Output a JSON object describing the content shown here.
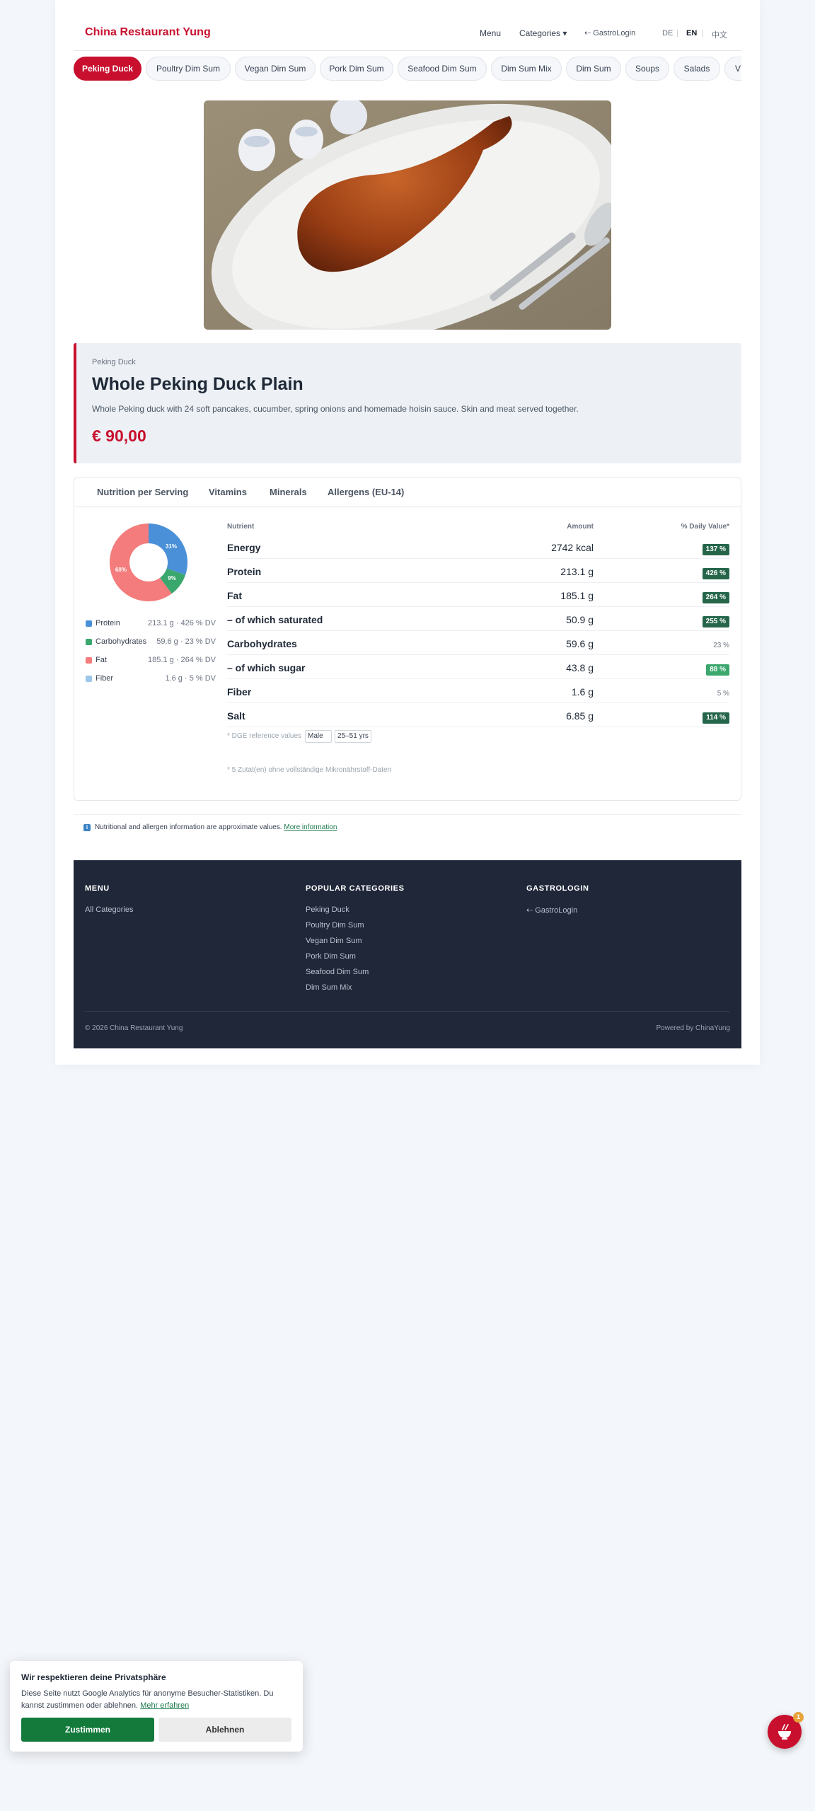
{
  "header": {
    "logo": "China Restaurant Yung",
    "nav_menu": "Menu",
    "nav_categories": "Categories ▾",
    "nav_login": "⇠ GastroLogin",
    "lang_de": "DE",
    "lang_sep": "|",
    "lang_en": "EN",
    "lang_zh": "中文"
  },
  "categories": [
    "Peking Duck",
    "Poultry Dim Sum",
    "Vegan Dim Sum",
    "Pork Dim Sum",
    "Seafood Dim Sum",
    "Dim Sum Mix",
    "Dim Sum",
    "Soups",
    "Salads",
    "V"
  ],
  "active_category": "Peking Duck",
  "dish": {
    "category": "Peking Duck",
    "title": "Whole Peking Duck Plain",
    "description": "Whole Peking duck with 24 soft pancakes, cucumber, spring onions and homemade hoisin sauce. Skin and meat served together.",
    "price": "€ 90,00"
  },
  "tabs": [
    "Nutrition per Serving",
    "Vitamins",
    "Minerals",
    "Allergens (EU-14)"
  ],
  "donut": {
    "labels": [
      "31%",
      "9%",
      "60%"
    ]
  },
  "legend": [
    {
      "name": "Protein",
      "value": "213.1 g · 426 % DV",
      "color": "#4a90d9"
    },
    {
      "name": "Carbohydrates",
      "value": "59.6 g · 23 % DV",
      "color": "#3aa76d"
    },
    {
      "name": "Fat",
      "value": "185.1 g · 264 % DV",
      "color": "#f47c7c"
    },
    {
      "name": "Fiber",
      "value": "1.6 g · 5 % DV",
      "color": "#9cc7ea"
    }
  ],
  "nutrition_table": {
    "col_nutrient": "Nutrient",
    "col_amount": "Amount",
    "col_dv": "% Daily Value*",
    "rows": [
      {
        "name": "Energy",
        "amount": "2742 kcal",
        "dv": "137 %",
        "style": "dark"
      },
      {
        "name": "Protein",
        "amount": "213.1 g",
        "dv": "426 %",
        "style": "dark"
      },
      {
        "name": "Fat",
        "amount": "185.1 g",
        "dv": "264 %",
        "style": "dark"
      },
      {
        "name": "– of which saturated",
        "amount": "50.9 g",
        "dv": "255 %",
        "style": "dark"
      },
      {
        "name": "Carbohydrates",
        "amount": "59.6 g",
        "dv": "23 %",
        "style": "plain"
      },
      {
        "name": "– of which sugar",
        "amount": "43.8 g",
        "dv": "88 %",
        "style": "light"
      },
      {
        "name": "Fiber",
        "amount": "1.6 g",
        "dv": "5 %",
        "style": "plain"
      },
      {
        "name": "Salt",
        "amount": "6.85 g",
        "dv": "114 %",
        "style": "dark"
      }
    ]
  },
  "reference": {
    "label": "* DGE reference values",
    "sex": "Male",
    "age": "25–51 yrs",
    "incomplete_note": "* 5 Zutat(en) ohne vollständige Mikronährstoff-Daten"
  },
  "info": {
    "icon": "i",
    "text": "Nutritional and allergen information are approximate values.",
    "link": "More information"
  },
  "footer": {
    "menu_title": "MENU",
    "menu_links": [
      "All Categories"
    ],
    "popular_title": "POPULAR CATEGORIES",
    "popular_links": [
      "Peking Duck",
      "Poultry Dim Sum",
      "Vegan Dim Sum",
      "Pork Dim Sum",
      "Seafood Dim Sum",
      "Dim Sum Mix"
    ],
    "gastro_title": "GASTROLOGIN",
    "gastro_links": [
      "⇠ GastroLogin"
    ],
    "copyright": "© 2026 China Restaurant Yung",
    "powered": "Powered by ChinaYung"
  },
  "cookie": {
    "title": "Wir respektieren deine Privatsphäre",
    "text": "Diese Seite nutzt Google Analytics für anonyme Besucher-Statistiken. Du kannst zustimmen oder ablehnen.",
    "link": "Mehr erfahren",
    "accept": "Zustimmen",
    "decline": "Ablehnen"
  },
  "fab": {
    "icon": "bowl-icon",
    "badge": "1"
  },
  "colors": {
    "brand_red": "#c8102e",
    "footer_bg": "#1f2739",
    "badge_dark": "#25664a",
    "badge_light": "#3aa76d",
    "accept_green": "#137a3c"
  }
}
